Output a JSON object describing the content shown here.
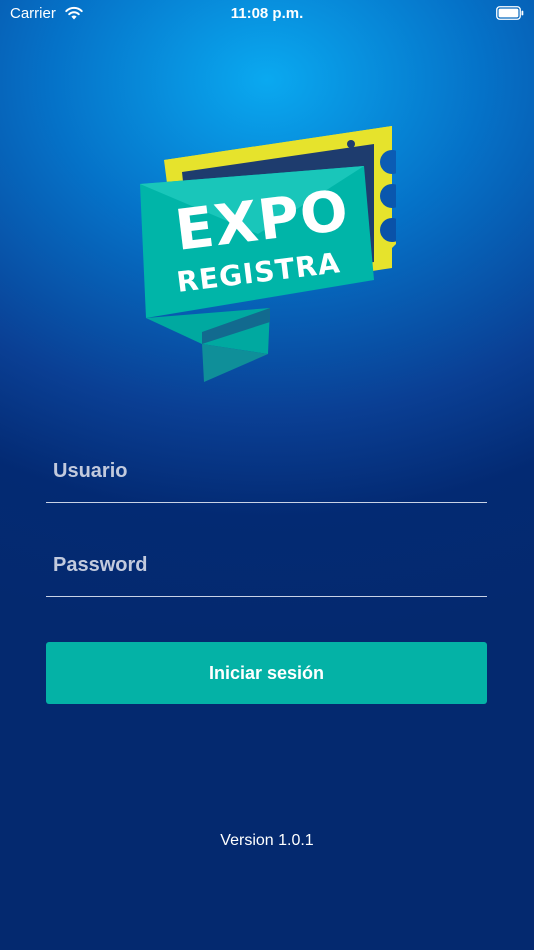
{
  "status_bar": {
    "carrier": "Carrier",
    "time": "11:08 p.m."
  },
  "logo": {
    "line1": "EXPO",
    "line2": "REGISTRA",
    "colors": {
      "teal_front": "#00b5a8",
      "teal_light": "#19c6ba",
      "navy_panel": "#1e3c6e",
      "yellow": "#e6e32c",
      "fold_shadow": "#0f8f99"
    }
  },
  "form": {
    "username_placeholder": "Usuario",
    "password_placeholder": "Password",
    "login_label": "Iniciar sesión"
  },
  "footer": {
    "version": "Version 1.0.1"
  },
  "colors": {
    "button": "#04b2a6",
    "background_top": "#0aa9f0",
    "background_bottom": "#04296f",
    "underline": "#c8d2e6"
  }
}
